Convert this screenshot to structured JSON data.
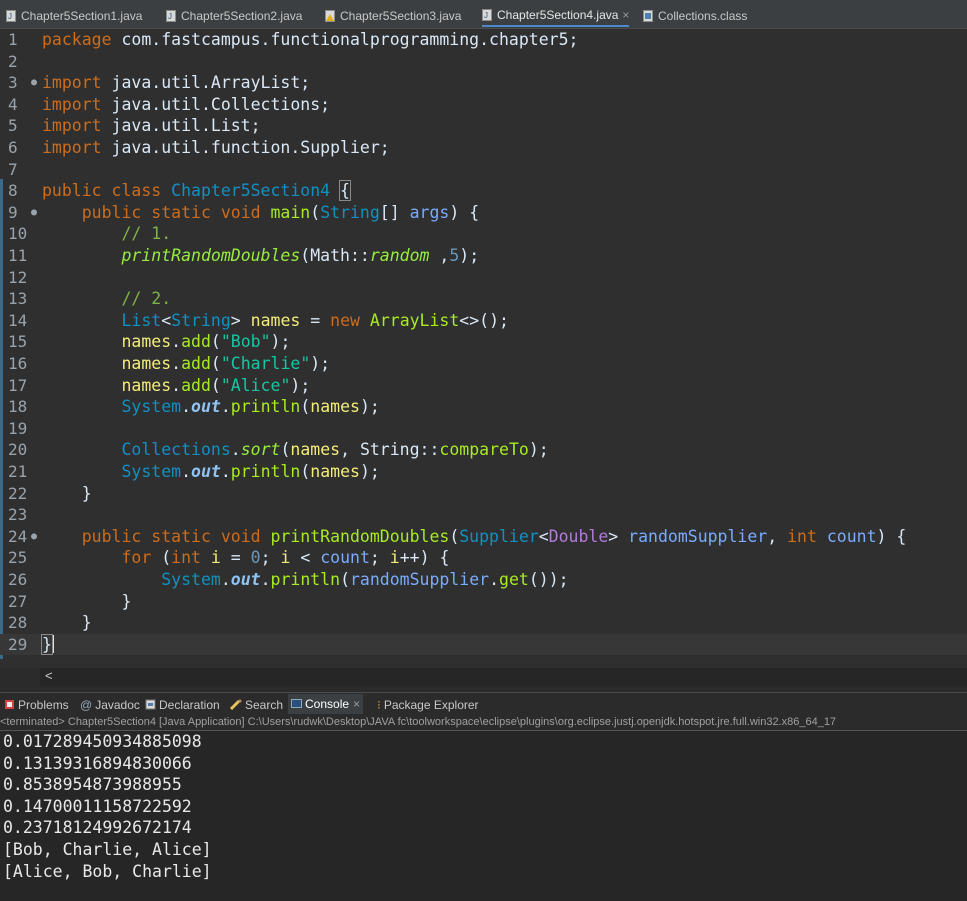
{
  "editor_tabs": [
    {
      "label": "Chapter5Section1.java",
      "active": false
    },
    {
      "label": "Chapter5Section2.java",
      "active": false
    },
    {
      "label": "Chapter5Section3.java",
      "active": false
    },
    {
      "label": "Chapter5Section4.java",
      "active": true
    },
    {
      "label": "Collections.class",
      "active": false
    }
  ],
  "line_numbers": [
    "1",
    "2",
    "3",
    "4",
    "5",
    "6",
    "7",
    "8",
    "9",
    "10",
    "11",
    "12",
    "13",
    "14",
    "15",
    "16",
    "17",
    "18",
    "19",
    "20",
    "21",
    "22",
    "23",
    "24",
    "25",
    "26",
    "27",
    "28",
    "29"
  ],
  "code": {
    "l1_kw": "package",
    "l1_rest": " com.fastcampus.functionalprogramming.chapter5;",
    "import_kw": "import",
    "l3": " java.util.ArrayList;",
    "l4": " java.util.Collections;",
    "l5": " java.util.List;",
    "l6": " java.util.function.Supplier;",
    "public_class": "public class",
    "class_name": "Chapter5Section4",
    "open_brace": "{",
    "public_static_void": "public static void",
    "main": "main",
    "string_type": "String",
    "args": "args",
    "comment1": "// 1.",
    "print_random_doubles": "printRandomDoubles",
    "math": "Math",
    "random": "random",
    "num5": "5",
    "comment2": "// 2.",
    "list": "List",
    "names": "names",
    "new_kw": "new",
    "arraylist": "ArrayList",
    "add": "add",
    "bob": "\"Bob\"",
    "charlie": "\"Charlie\"",
    "alice": "\"Alice\"",
    "system": "System",
    "out": "out",
    "println": "println",
    "collections": "Collections",
    "sort": "sort",
    "compare_to": "compareTo",
    "supplier": "Supplier",
    "double_type": "Double",
    "random_supplier": "randomSupplier",
    "int_kw": "int",
    "count": "count",
    "for_kw": "for",
    "i_var": "i",
    "zero": "0",
    "get": "get",
    "close_brace": "}"
  },
  "hscroll_arrow": "<",
  "view_tabs": [
    {
      "label": "Problems",
      "icon": "problems-icon",
      "active": false
    },
    {
      "label": "Javadoc",
      "icon": "at-icon",
      "active": false
    },
    {
      "label": "Declaration",
      "icon": "declaration-icon",
      "active": false
    },
    {
      "label": "Search",
      "icon": "search-icon",
      "active": false
    },
    {
      "label": "Console",
      "icon": "console-icon",
      "active": true
    },
    {
      "label": "Package Explorer",
      "icon": "package-explorer-icon",
      "active": false
    }
  ],
  "status_line": "<terminated> Chapter5Section4 [Java Application] C:\\Users\\rudwk\\Desktop\\JAVA fc\\toolworkspace\\eclipse\\plugins\\org.eclipse.justj.openjdk.hotspot.jre.full.win32.x86_64_17",
  "console_output": [
    "0.017289450934885098",
    "0.13139316894830066",
    "0.8538954873988955",
    "0.14700011158722592",
    "0.23718124992672174",
    "[Bob, Charlie, Alice]",
    "[Alice, Bob, Charlie]"
  ],
  "colors": {
    "background": "#2f2f2f",
    "keyword": "#cc6c1d",
    "type": "#1290c3",
    "string": "#17c6a3",
    "comment": "#7fb347",
    "method": "#a7ec21"
  }
}
